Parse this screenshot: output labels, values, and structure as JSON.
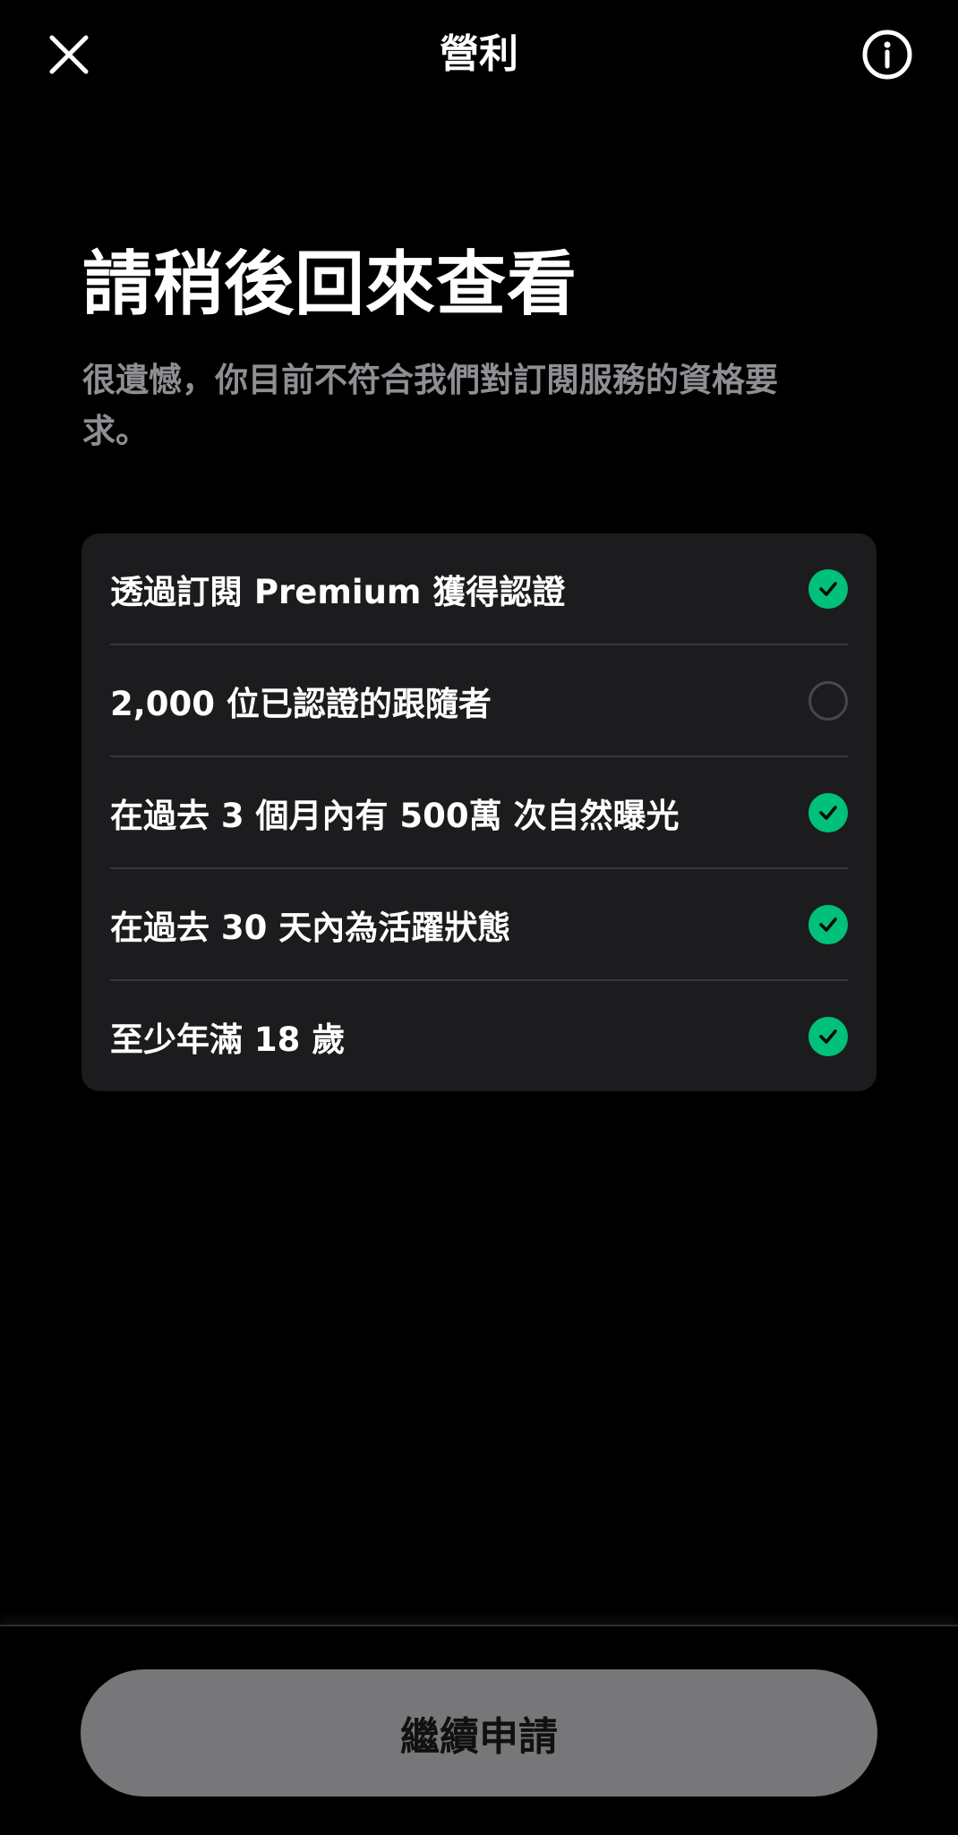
{
  "header": {
    "title": "營利"
  },
  "main": {
    "headline": "請稍後回來查看",
    "subtitle": "很遺憾，你目前不符合我們對訂閱服務的資格要求。",
    "requirements": [
      {
        "label": "透過訂閱 Premium 獲得認證",
        "met": true
      },
      {
        "label": "2,000 位已認證的跟隨者",
        "met": false
      },
      {
        "label": "在過去 3 個月內有 500萬 次自然曝光",
        "met": true
      },
      {
        "label": "在過去 30 天內為活躍狀態",
        "met": true
      },
      {
        "label": "至少年滿 18 歲",
        "met": true
      }
    ]
  },
  "footer": {
    "continue_label": "繼續申請"
  },
  "colors": {
    "background": "#000000",
    "card": "#1c1c1e",
    "success": "#00c07a",
    "muted_text": "#8e8e93",
    "button_disabled": "#77777a"
  },
  "icons": {
    "close": "close-icon",
    "info": "info-icon",
    "check": "check-circle-icon",
    "empty": "empty-circle-icon"
  }
}
